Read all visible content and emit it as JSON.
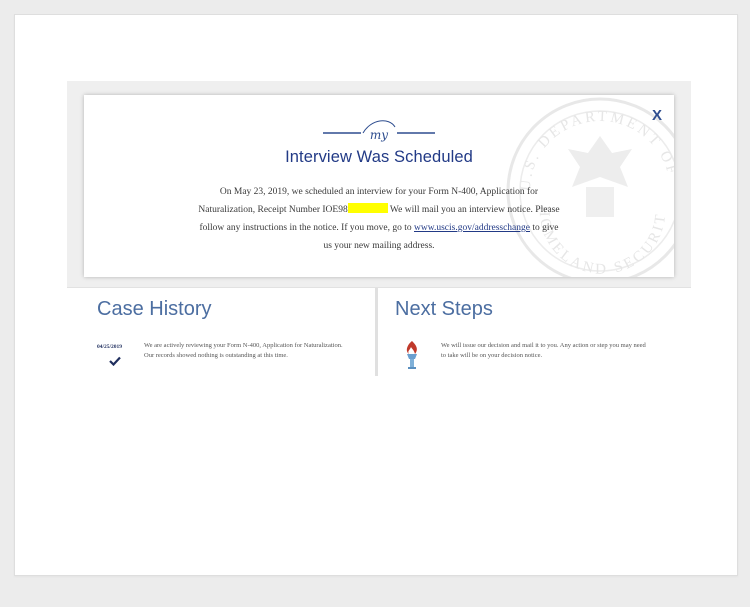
{
  "modal": {
    "logo_text": "my",
    "title": "Interview Was Scheduled",
    "body_part1": "On May 23, 2019, we scheduled an interview for your Form N-400, Application for Naturalization, Receipt Number IOE98",
    "body_part2": "We will mail you an interview notice. Please follow any instructions in the notice. If you move, go to",
    "link_text": "www.uscis.gov/addresschange",
    "body_part3": "to give us your new mailing address.",
    "close_label": "X",
    "seal_text": "U.S. DEPARTMENT OF HOMELAND SECURITY"
  },
  "case_history": {
    "heading": "Case History",
    "items": [
      {
        "date": "04/25/2019",
        "text": "We are actively reviewing your Form N-400, Application for Naturalization. Our records showed nothing is outstanding at this time."
      }
    ]
  },
  "next_steps": {
    "heading": "Next Steps",
    "text": "We will issue our decision and mail it to you.  Any action or step you may need to take will be on your decision notice."
  },
  "colors": {
    "title_blue": "#223a86",
    "heading_blue": "#4c6ea1",
    "redaction": "#ffff00"
  },
  "icons": [
    "my-uscis-logo-icon",
    "close-icon",
    "dhs-seal-icon",
    "checkmark-icon",
    "torch-icon"
  ]
}
